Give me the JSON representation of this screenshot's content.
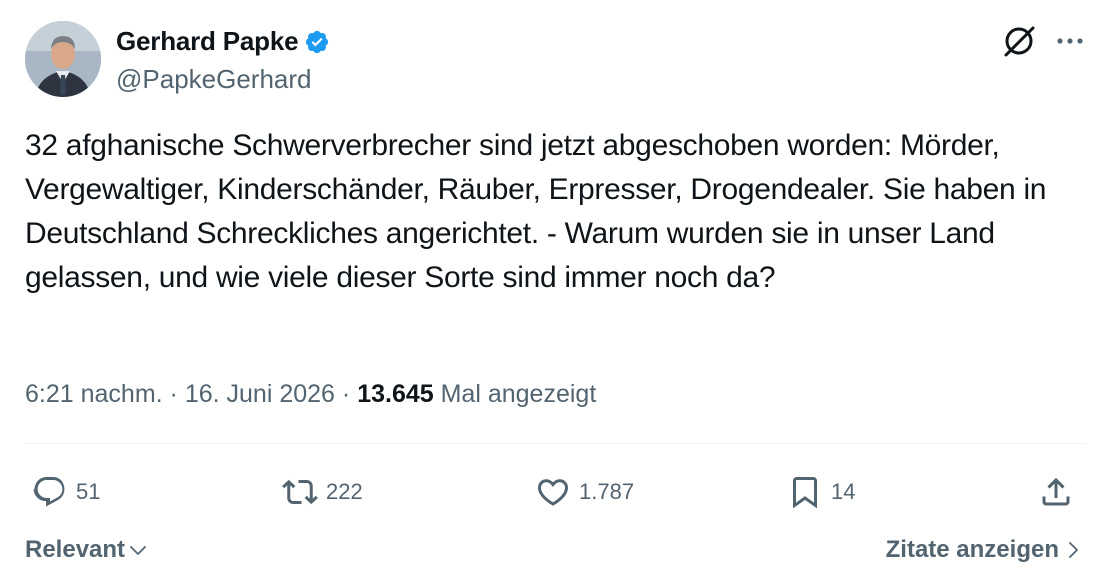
{
  "author": {
    "name": "Gerhard Papke",
    "handle": "@PapkeGerhard",
    "verified": true
  },
  "tweet": {
    "text": "32 afghanische Schwerverbrecher sind jetzt abgeschoben worden: Mörder, Vergewaltiger, Kinderschänder, Räuber, Erpresser, Drogendealer. Sie haben in Deutschland Schreckliches angerichtet. - Warum wurden sie in unser Land gelassen, und wie viele dieser Sorte sind immer noch da?"
  },
  "meta": {
    "time": "6:21 nachm.",
    "separator": "·",
    "date": "16. Juni 2026",
    "views_count": "13.645",
    "views_label": "Mal angezeigt"
  },
  "actions": {
    "replies": "51",
    "retweets": "222",
    "likes": "1.787",
    "bookmarks": "14"
  },
  "footer": {
    "sort_label": "Relevant",
    "quotes_label": "Zitate anzeigen"
  },
  "colors": {
    "text_primary": "#0f1419",
    "text_secondary": "#536471",
    "verified_blue": "#1d9bf0",
    "divider": "#eff3f4"
  },
  "icons": {
    "verified": "verified-badge-icon",
    "grok": "grok-icon",
    "more": "more-dots-icon",
    "reply": "reply-icon",
    "retweet": "retweet-icon",
    "like": "heart-icon",
    "bookmark": "bookmark-icon",
    "share": "share-icon",
    "chevron_down": "chevron-down-icon",
    "chevron_right": "chevron-right-icon"
  }
}
